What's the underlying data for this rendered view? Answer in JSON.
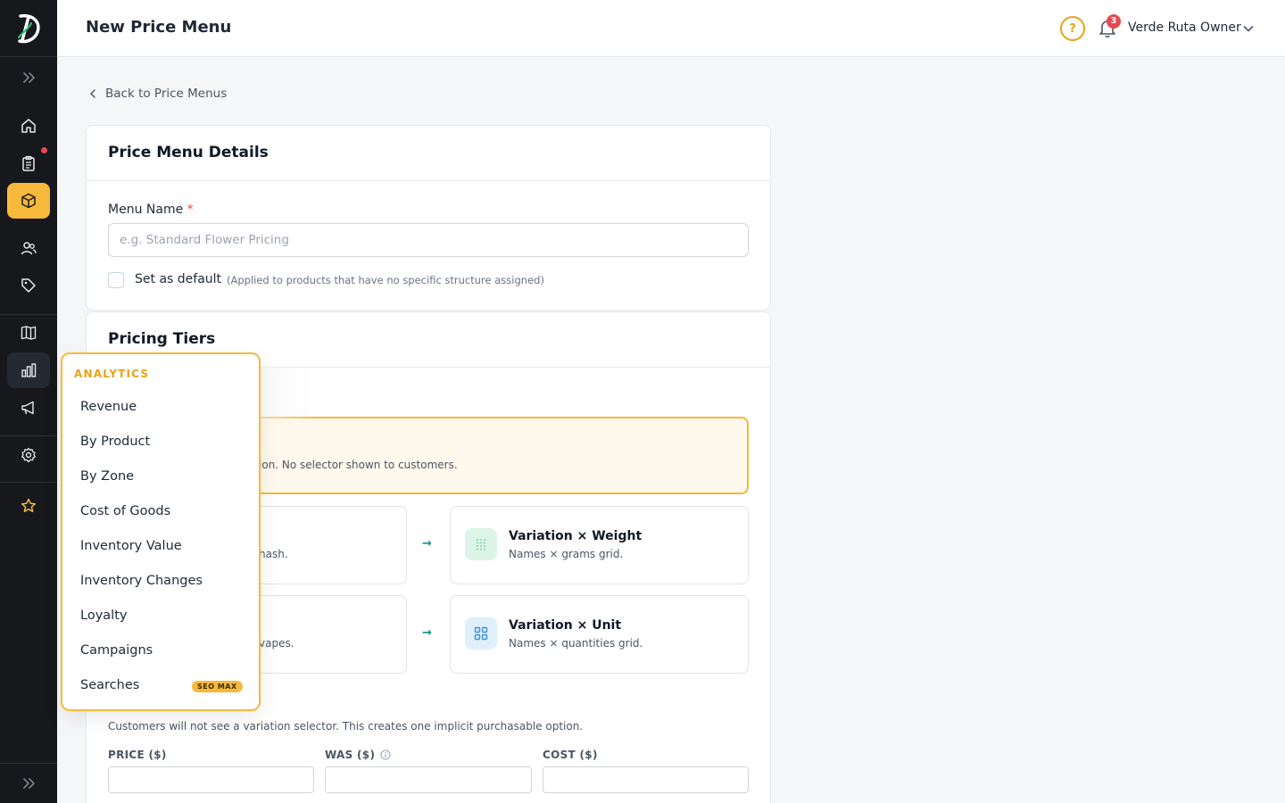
{
  "header": {
    "title": "New Price Menu",
    "help_icon_glyph": "?",
    "notifications_count": "3",
    "user_name": "Verde Ruta Owner"
  },
  "sidebar": {
    "logo_letter": "D",
    "items": [
      {
        "name": "home",
        "icon": "home-icon"
      },
      {
        "name": "orders",
        "icon": "clipboard-icon",
        "has_notification": true
      },
      {
        "name": "products",
        "icon": "box-icon",
        "active": true
      },
      {
        "name": "customers",
        "icon": "users-icon"
      },
      {
        "name": "discounts",
        "icon": "tag-icon"
      },
      {
        "name": "catalog",
        "icon": "book-icon"
      },
      {
        "name": "analytics",
        "icon": "bar-chart-icon",
        "hover": true
      },
      {
        "name": "marketing",
        "icon": "megaphone-icon"
      },
      {
        "name": "settings",
        "icon": "gear-icon"
      },
      {
        "name": "favorites",
        "icon": "star-icon"
      }
    ]
  },
  "back_link": "Back to Price Menus",
  "details_card": {
    "title": "Price Menu Details",
    "menu_name_label": "Menu Name",
    "required_mark": "*",
    "menu_name_placeholder": "e.g. Standard Flower Pricing",
    "menu_name_value": "",
    "default_label": "Set as default",
    "default_hint": "(Applied to products that have no specific structure assigned)",
    "default_checked": false
  },
  "tiers_card": {
    "title": "Pricing Tiers",
    "selected_option_desc": "ion. No selector shown to customers.",
    "options": [
      {
        "left_desc": "hash.",
        "title": "Variation × Weight",
        "desc": "Names × grams grid.",
        "icon": "grid-dots-icon"
      },
      {
        "left_desc": "vapes.",
        "title": "Variation × Unit",
        "desc": "Names × quantities grid.",
        "icon": "grid-squares-icon"
      }
    ],
    "arrow_glyph": "→",
    "note": "Customers will not see a variation selector. This creates one implicit purchasable option.",
    "columns": {
      "price": "PRICE ($)",
      "was": "WAS ($)",
      "cost": "COST ($)"
    }
  },
  "analytics_menu": {
    "header": "ANALYTICS",
    "items": [
      "Revenue",
      "By Product",
      "By Zone",
      "Cost of Goods",
      "Inventory Value",
      "Inventory Changes",
      "Loyalty",
      "Campaigns",
      "Searches"
    ],
    "searches_badge": "SEO MAX"
  },
  "colors": {
    "accent": "#f6b93b",
    "sidebar_bg": "#16181b",
    "danger": "#e5484d",
    "teal": "#0d9488"
  }
}
